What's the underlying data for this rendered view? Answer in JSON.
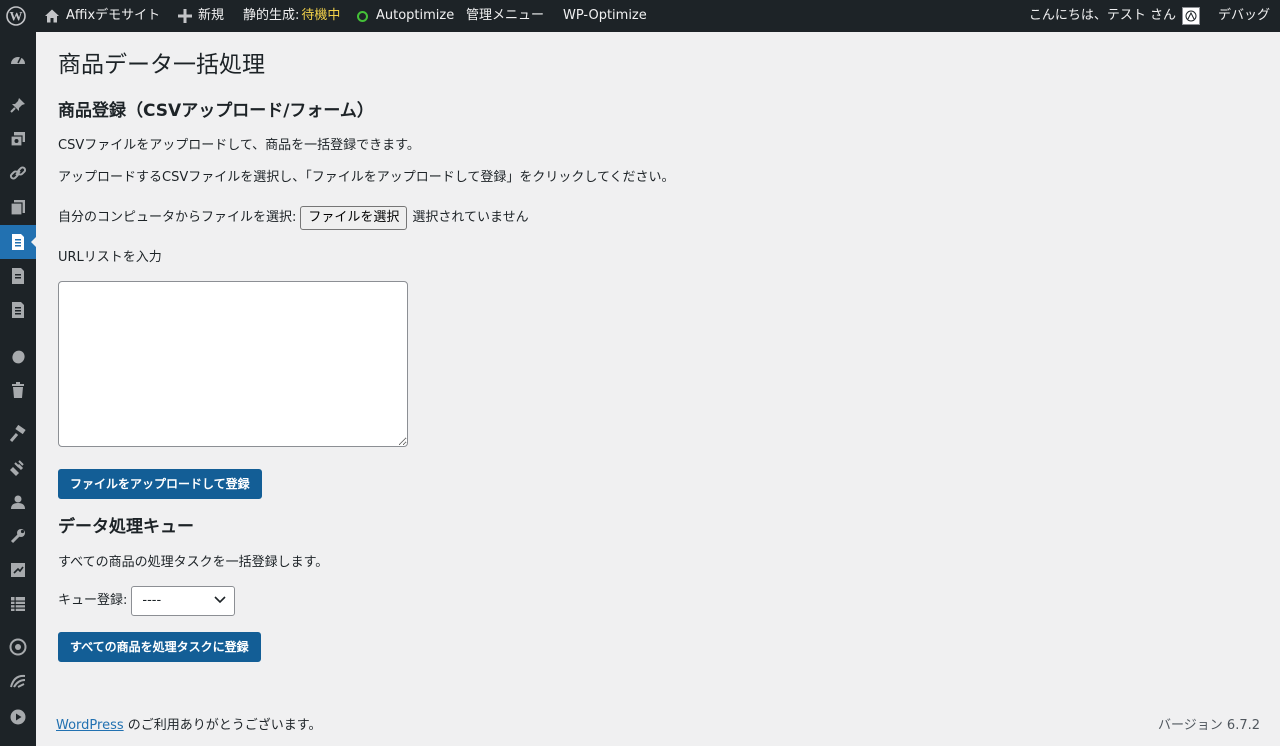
{
  "admin_bar": {
    "site_name": "Affixデモサイト",
    "new_label": "新規",
    "static_label": "静的生成:",
    "static_status": "待機中",
    "autoptimize": "Autoptimize",
    "admin_menu": "管理メニュー",
    "wp_optimize": "WP-Optimize",
    "greeting": "こんにちは、テスト さん",
    "debug": "デバッグ"
  },
  "page": {
    "title": "商品データ一括処理",
    "csv_section": {
      "heading": "商品登録（CSVアップロード/フォーム）",
      "description": "CSVファイルをアップロードして、商品を一括登録できます。",
      "instruction": "アップロードするCSVファイルを選択し、「ファイルをアップロードして登録」をクリックしてください。",
      "file_label": "自分のコンピュータからファイルを選択:",
      "file_button": "ファイルを選択",
      "file_status": "選択されていません",
      "url_label": "URLリストを入力",
      "url_value": "",
      "submit": "ファイルをアップロードして登録"
    },
    "queue_section": {
      "heading": "データ処理キュー",
      "description": "すべての商品の処理タスクを一括登録します。",
      "select_label": "キュー登録:",
      "select_value": "----",
      "submit": "すべての商品を処理タスクに登録"
    }
  },
  "footer": {
    "link": "WordPress",
    "thanks": " のご利用ありがとうございます。",
    "version": "バージョン 6.7.2"
  },
  "colors": {
    "admin_bar_bg": "#1d2327",
    "primary_button": "#135e96",
    "current_menu": "#2271b1",
    "status_yellow": "#f2d14a",
    "autoptimize_green": "#44c038"
  }
}
